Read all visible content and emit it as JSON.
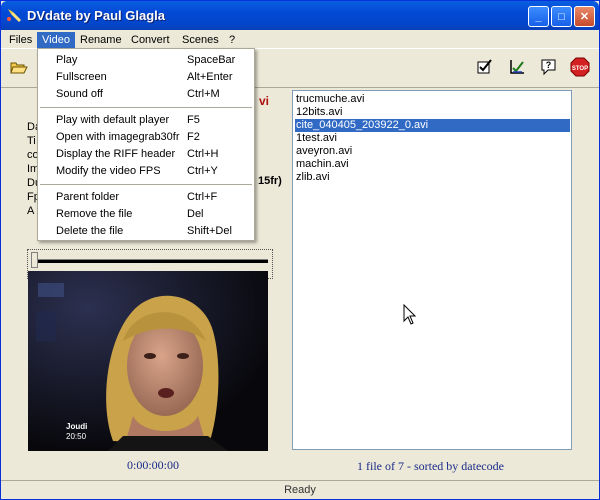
{
  "window": {
    "title": "DVdate by Paul Glagla"
  },
  "titlebar_buttons": {
    "minimize": "_",
    "maximize": "□",
    "close": "✕"
  },
  "menu": [
    "Files",
    "Video",
    "Rename",
    "Convert",
    "Scenes",
    "?"
  ],
  "video_menu": {
    "group1": [
      {
        "label": "Play",
        "shortcut": "SpaceBar"
      },
      {
        "label": "Fullscreen",
        "shortcut": "Alt+Enter"
      },
      {
        "label": "Sound off",
        "shortcut": "Ctrl+M"
      }
    ],
    "group2": [
      {
        "label": "Play with default player",
        "shortcut": "F5"
      },
      {
        "label": "Open with imagegrab30fr",
        "shortcut": "F2"
      },
      {
        "label": "Display the RIFF header",
        "shortcut": "Ctrl+H"
      },
      {
        "label": "Modify the video FPS",
        "shortcut": "Ctrl+Y"
      }
    ],
    "group3": [
      {
        "label": "Parent folder",
        "shortcut": "Ctrl+F"
      },
      {
        "label": "Remove the file",
        "shortcut": "Del"
      },
      {
        "label": "Delete the file",
        "shortcut": "Shift+Del"
      }
    ]
  },
  "info_partial": {
    "r1": "Da",
    "r2": "Ti",
    "r3": "co",
    "r4": "Im",
    "r5": "Du",
    "r6": "Fp",
    "r7": "A",
    "header_fragment": "vi",
    "fps_fragment": "15fr)"
  },
  "video": {
    "overlay_line1": "Joudi",
    "overlay_line2": "20:50"
  },
  "timecode": "0:00:00:00",
  "files": [
    "trucmuche.avi",
    "12bits.avi",
    "cite_040405_203922_0.avi",
    "1test.avi",
    "aveyron.avi",
    "machin.avi",
    "zlib.avi"
  ],
  "selected_index": 2,
  "list_status": "1 file of 7 - sorted by datecode",
  "status": "Ready",
  "colors": {
    "title_blue": "#0349d6",
    "selection": "#316ac5",
    "text_blue": "#1a2a8a",
    "stop": "#d42020"
  }
}
